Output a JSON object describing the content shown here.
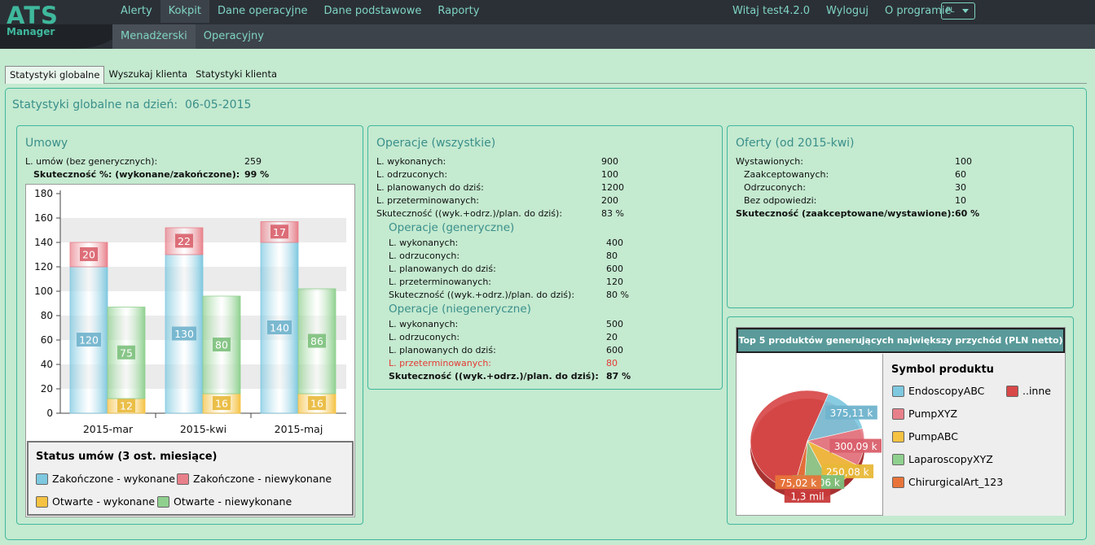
{
  "app": {
    "logo_line1": "ATS",
    "logo_line2": "Manager"
  },
  "nav": {
    "items": [
      "Alerty",
      "Kokpit",
      "Dane operacyjne",
      "Dane podstawowe",
      "Raporty"
    ],
    "active": "Kokpit",
    "subitems": [
      "Menadżerski",
      "Operacyjny"
    ],
    "sub_active": "Menadżerski",
    "welcome": "Witaj test4.2.0",
    "logout": "Wyloguj",
    "about": "O programie",
    "lang": "PL"
  },
  "tabs": [
    "Statystyki globalne",
    "Wyszukaj klienta",
    "Statystyki klienta"
  ],
  "page": {
    "title": "Statystyki globalne na dzień:",
    "date": "06-05-2015"
  },
  "umowy": {
    "title": "Umowy",
    "rows": [
      {
        "label": "L. umów (bez generycznych):",
        "value": "259"
      },
      {
        "label": "Skuteczność %: (wykonane/zakończone):",
        "value": "99 %"
      }
    ]
  },
  "operacje": {
    "title": "Operacje (wszystkie)",
    "rows": [
      {
        "label": "L. wykonanych:",
        "value": "900"
      },
      {
        "label": "L. odrzuconych:",
        "value": "100"
      },
      {
        "label": "L. planowanych do dziś:",
        "value": "1200"
      },
      {
        "label": "L. przeterminowanych:",
        "value": "200"
      },
      {
        "label": "Skuteczność ((wyk.+odrz.)/plan. do dziś):",
        "value": "83 %"
      }
    ],
    "gen_title": "Operacje (generyczne)",
    "gen_rows": [
      {
        "label": "L. wykonanych:",
        "value": "400"
      },
      {
        "label": "L. odrzuconych:",
        "value": "80"
      },
      {
        "label": "L. planowanych do dziś:",
        "value": "600"
      },
      {
        "label": "L. przeterminowanych:",
        "value": "120"
      },
      {
        "label": "Skuteczność ((wyk.+odrz.)/plan. do dziś):",
        "value": "80 %"
      }
    ],
    "nongen_title": "Operacje (niegeneryczne)",
    "nongen_rows": [
      {
        "label": "L. wykonanych:",
        "value": "500"
      },
      {
        "label": "L. odrzuconych:",
        "value": "20"
      },
      {
        "label": "L. planowanych do dziś:",
        "value": "600"
      },
      {
        "label": "L. przeterminowanych:",
        "value": "80"
      },
      {
        "label": "Skuteczność ((wyk.+odrz.)/plan. do dziś):",
        "value": "87 %"
      }
    ]
  },
  "oferty": {
    "title": "Oferty (od 2015-kwi)",
    "rows": [
      {
        "label": "Wystawionych:",
        "value": "100"
      },
      {
        "label": "Zaakceptowanych:",
        "value": "60"
      },
      {
        "label": "Odrzuconych:",
        "value": "30"
      },
      {
        "label": "Bez odpowiedzi:",
        "value": "10"
      },
      {
        "label": "Skuteczność (zaakceptowane/wystawione):",
        "value": "60 %"
      }
    ]
  },
  "chart_data": [
    {
      "type": "bar",
      "categories": [
        "2015-mar",
        "2015-kwi",
        "2015-maj"
      ],
      "ylim": [
        0,
        180
      ],
      "yticks": [
        0,
        20,
        40,
        60,
        80,
        100,
        120,
        140,
        160,
        180
      ],
      "legend_title": "Status umów (3 ost. miesiące)",
      "series": [
        {
          "name": "Zakończone - wykonane",
          "values": [
            120,
            130,
            140
          ],
          "color": "#7ec8e0",
          "stack": "zak"
        },
        {
          "name": "Zakończone - niewykonane",
          "values": [
            20,
            22,
            17
          ],
          "color": "#e8808a",
          "stack": "zak"
        },
        {
          "name": "Otwarte - wykonane",
          "values": [
            12,
            16,
            16
          ],
          "color": "#f5c242",
          "stack": "otw"
        },
        {
          "name": "Otwarte - niewykonane",
          "values": [
            75,
            80,
            86
          ],
          "color": "#8fd08f",
          "stack": "otw"
        }
      ]
    },
    {
      "type": "pie",
      "title": "Top 5 produktów generujących największy przychód (PLN netto)",
      "legend_title": "Symbol produktu",
      "slices": [
        {
          "name": "EndoscopyABC",
          "value": 375110,
          "label": "375,11 k",
          "color": "#7ec8e0"
        },
        {
          "name": "PumpXYZ",
          "value": 300090,
          "label": "300,09 k",
          "color": "#e8808a"
        },
        {
          "name": "PumpABC",
          "value": 250080,
          "label": "250,08 k",
          "color": "#f5c242"
        },
        {
          "name": "LaparoscopyXYZ",
          "value": 200060,
          "label": "200,06 k",
          "color": "#8fd08f"
        },
        {
          "name": "ChirurgicalArt_123",
          "value": 75020,
          "label": "75,02 k",
          "color": "#e8743a"
        },
        {
          "name": "..inne",
          "value": 1300000,
          "label": "1,3 mil",
          "color": "#d84848"
        }
      ]
    }
  ]
}
